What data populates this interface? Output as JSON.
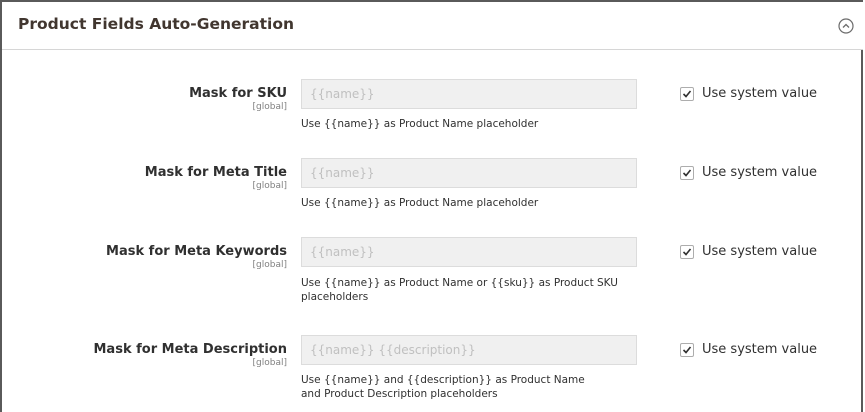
{
  "section": {
    "title": "Product Fields Auto-Generation"
  },
  "fields": [
    {
      "label": "Mask for SKU",
      "scope": "[global]",
      "value": "{{name}}",
      "note": "Use {{name}} as Product Name placeholder",
      "use_system_label": "Use system value",
      "use_system_checked": true
    },
    {
      "label": "Mask for Meta Title",
      "scope": "[global]",
      "value": "{{name}}",
      "note": "Use {{name}} as Product Name placeholder",
      "use_system_label": "Use system value",
      "use_system_checked": true
    },
    {
      "label": "Mask for Meta Keywords",
      "scope": "[global]",
      "value": "{{name}}",
      "note": "Use {{name}} as Product Name or {{sku}} as Product SKU placeholders",
      "use_system_label": "Use system value",
      "use_system_checked": true
    },
    {
      "label": "Mask for Meta Description",
      "scope": "[global]",
      "value": "{{name}} {{description}}",
      "note": "Use {{name}} and {{description}} as Product Name and Product Description placeholders",
      "use_system_label": "Use system value",
      "use_system_checked": true
    }
  ]
}
